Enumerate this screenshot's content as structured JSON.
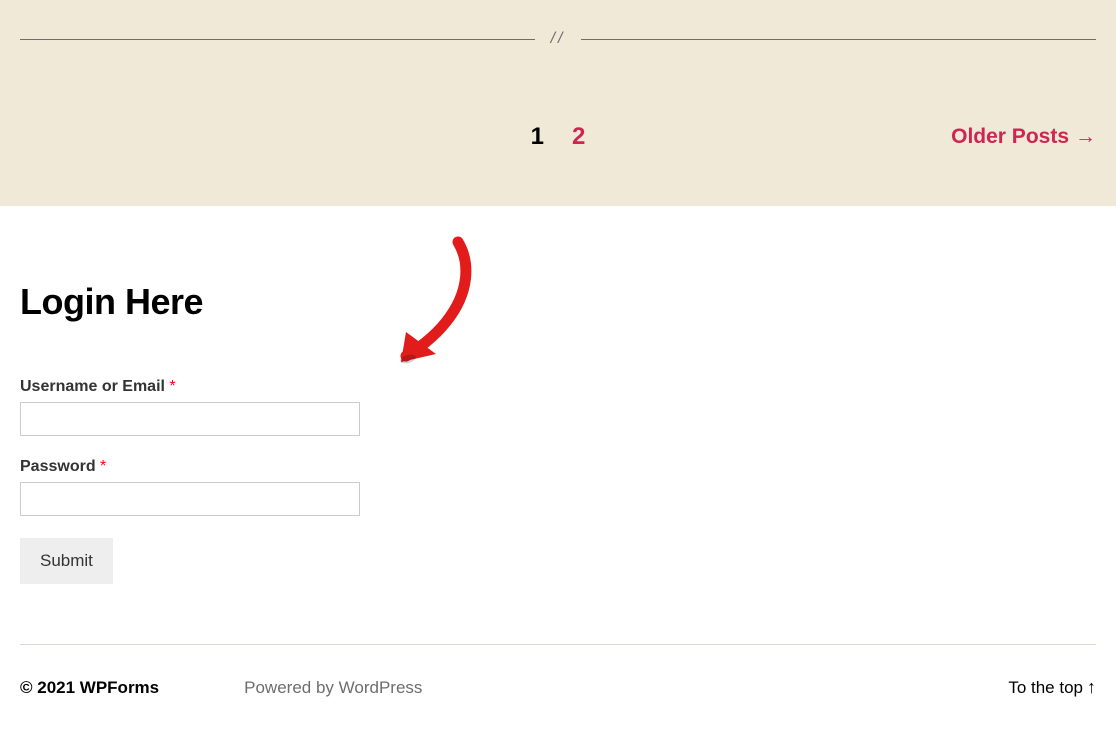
{
  "pagination": {
    "current_page": "1",
    "page_link": "2",
    "older_posts_label": "Older Posts"
  },
  "login_form": {
    "heading": "Login Here",
    "username_label": "Username or Email",
    "password_label": "Password",
    "required_marker": "*",
    "submit_label": "Submit",
    "username_value": "",
    "password_value": ""
  },
  "footer": {
    "copyright": "© 2021 WPForms",
    "powered_by": "Powered by WordPress",
    "to_top_label": "To the top"
  },
  "divider_marks": "//"
}
